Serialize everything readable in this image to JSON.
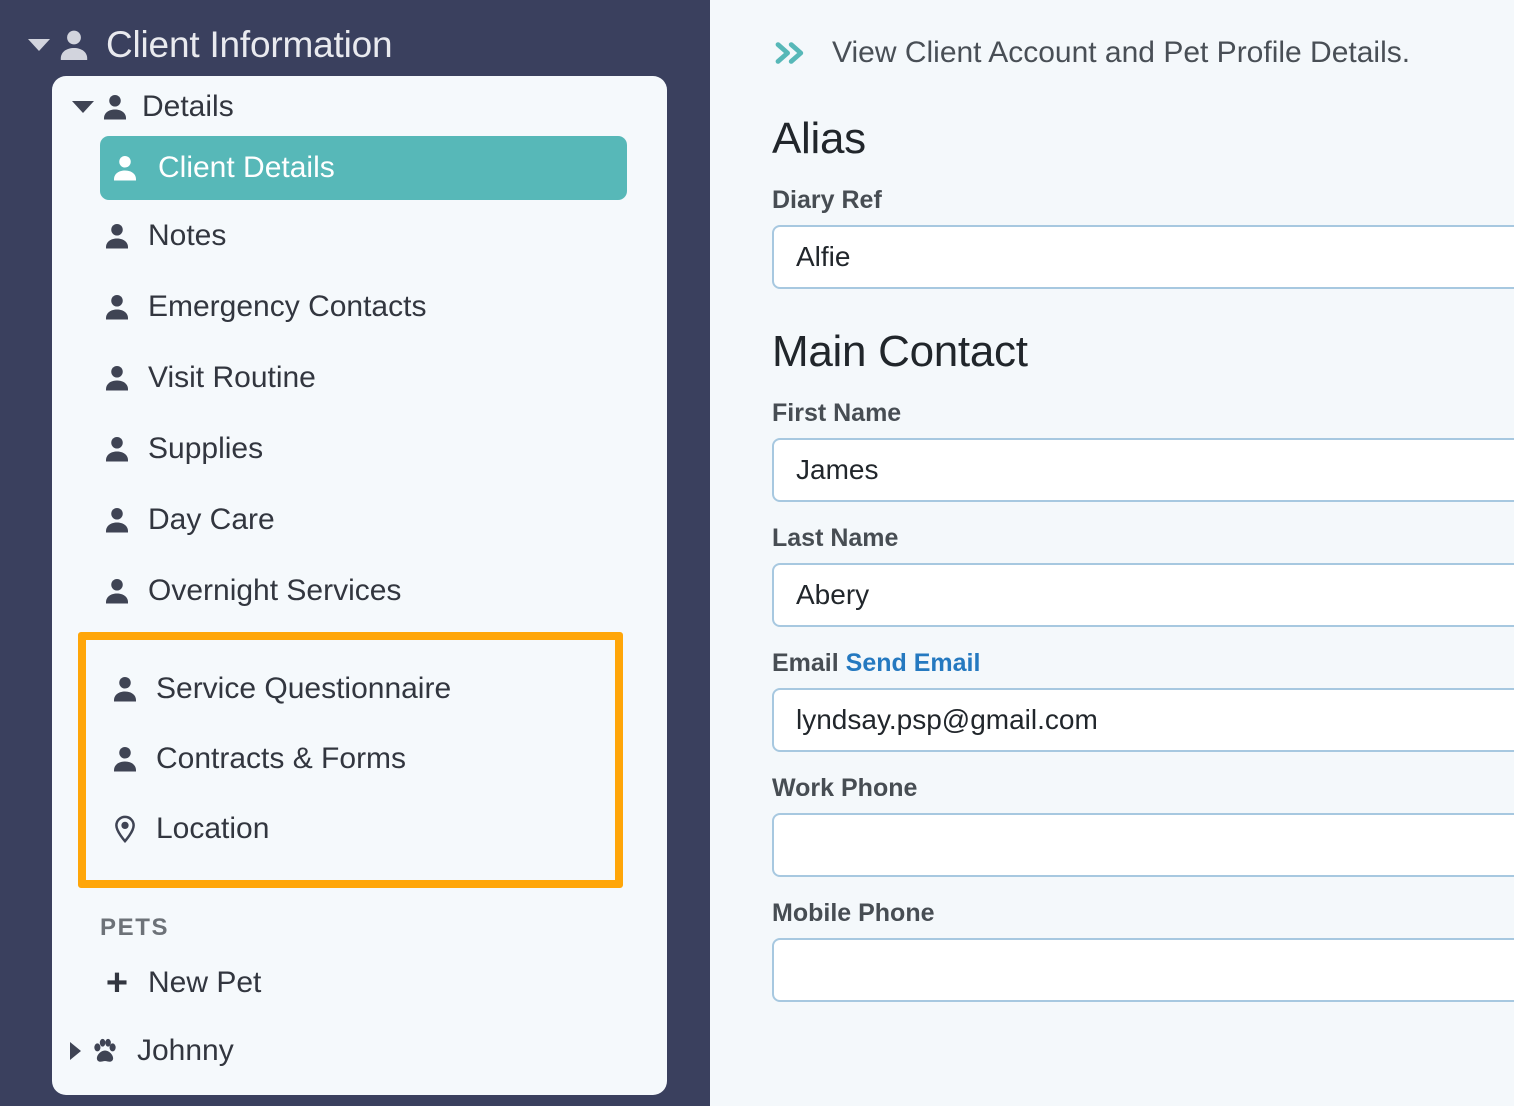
{
  "sidebar": {
    "header": {
      "title": "Client Information",
      "icon": "user-icon",
      "toggle": "caret-down-icon"
    },
    "group": {
      "label": "Details",
      "icon": "user-icon",
      "toggle": "caret-down-icon"
    },
    "items": [
      {
        "label": "Client Details",
        "icon": "user-icon",
        "active": true
      },
      {
        "label": "Notes",
        "icon": "user-icon",
        "active": false
      },
      {
        "label": "Emergency Contacts",
        "icon": "user-icon",
        "active": false
      },
      {
        "label": "Visit Routine",
        "icon": "user-icon",
        "active": false
      },
      {
        "label": "Supplies",
        "icon": "user-icon",
        "active": false
      },
      {
        "label": "Day Care",
        "icon": "user-icon",
        "active": false
      },
      {
        "label": "Overnight Services",
        "icon": "user-icon",
        "active": false
      }
    ],
    "highlighted_items": [
      {
        "label": "Service Questionnaire",
        "icon": "user-icon"
      },
      {
        "label": "Contracts & Forms",
        "icon": "user-icon"
      },
      {
        "label": "Location",
        "icon": "map-pin-icon"
      }
    ],
    "pets_section_label": "PETS",
    "new_pet": {
      "label": "New Pet",
      "icon": "plus-icon"
    },
    "pets": [
      {
        "label": "Johnny",
        "icon": "paw-icon",
        "toggle": "caret-right-icon"
      }
    ]
  },
  "main": {
    "topbar": {
      "icon": "double-chevron-right-icon",
      "text": "View Client Account and Pet Profile Details."
    },
    "alias": {
      "title": "Alias",
      "diary_ref": {
        "label": "Diary Ref",
        "value": "Alfie",
        "placeholder": ""
      }
    },
    "main_contact": {
      "title": "Main Contact",
      "first_name": {
        "label": "First Name",
        "value": "James",
        "placeholder": ""
      },
      "last_name": {
        "label": "Last Name",
        "value": "Abery",
        "placeholder": ""
      },
      "email": {
        "label": "Email",
        "link_label": "Send Email",
        "value": "lyndsay.psp@gmail.com",
        "placeholder": ""
      },
      "work_phone": {
        "label": "Work Phone",
        "value": "",
        "placeholder": ""
      },
      "mobile_phone": {
        "label": "Mobile Phone",
        "value": "",
        "placeholder": ""
      }
    }
  },
  "colors": {
    "sidebar_bg": "#3a405e",
    "panel_bg": "#f4f8fb",
    "card_bg": "#f5f9fc",
    "accent_teal": "#57b8b8",
    "highlight_orange": "#ffa609",
    "link_blue": "#2579c0",
    "input_border": "#a7c8e0"
  }
}
